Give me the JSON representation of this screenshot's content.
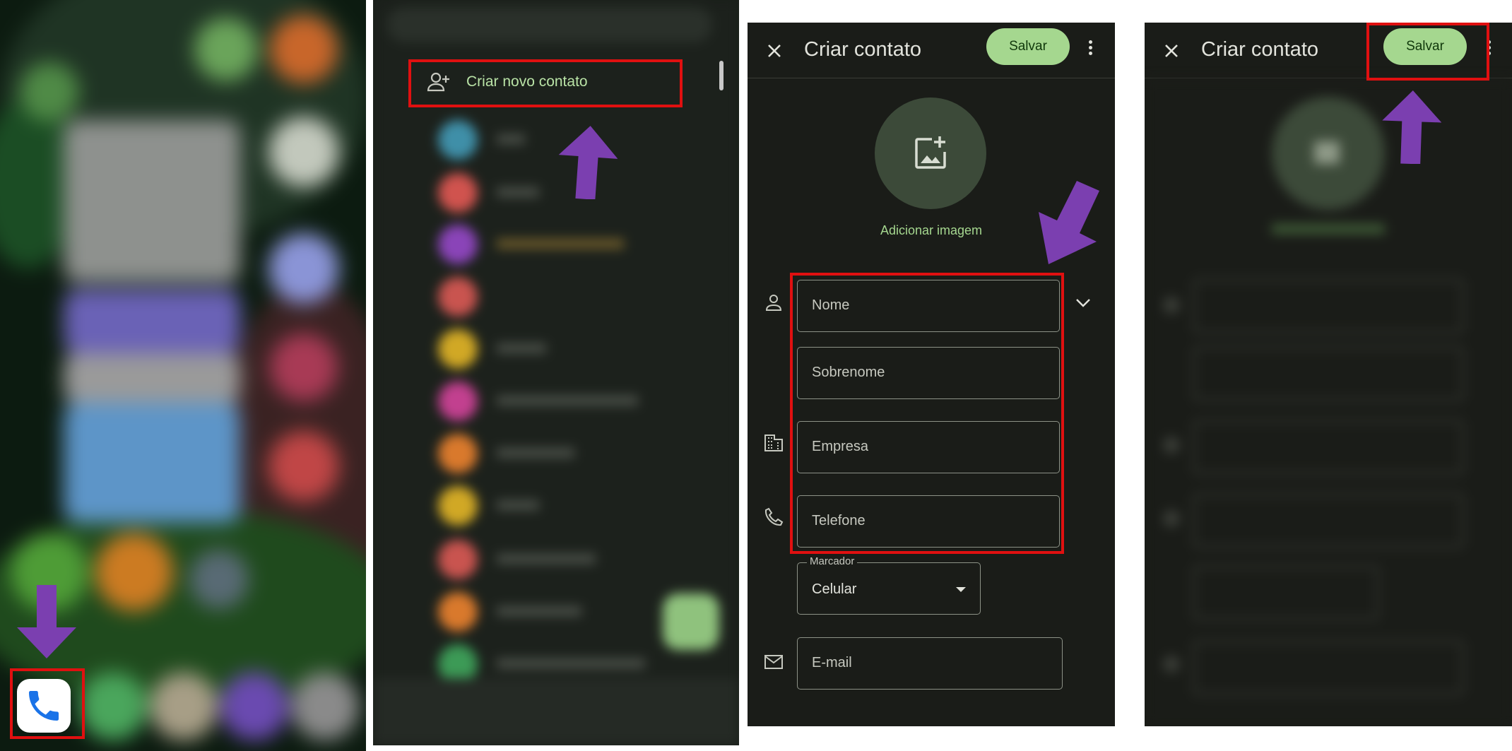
{
  "colors": {
    "highlight": "#e01010",
    "arrow": "#7b3fb0",
    "accent": "#a5d78f"
  },
  "panel1": {
    "icon": "phone-icon"
  },
  "panel2": {
    "create_contact": "Criar novo contato"
  },
  "panel3": {
    "title": "Criar contato",
    "save": "Salvar",
    "add_image": "Adicionar imagem",
    "fields": {
      "name": "Nome",
      "surname": "Sobrenome",
      "company": "Empresa",
      "phone": "Telefone",
      "email": "E-mail"
    },
    "label_caption": "Marcador",
    "label_value": "Celular"
  },
  "panel4": {
    "title": "Criar contato",
    "save": "Salvar"
  }
}
